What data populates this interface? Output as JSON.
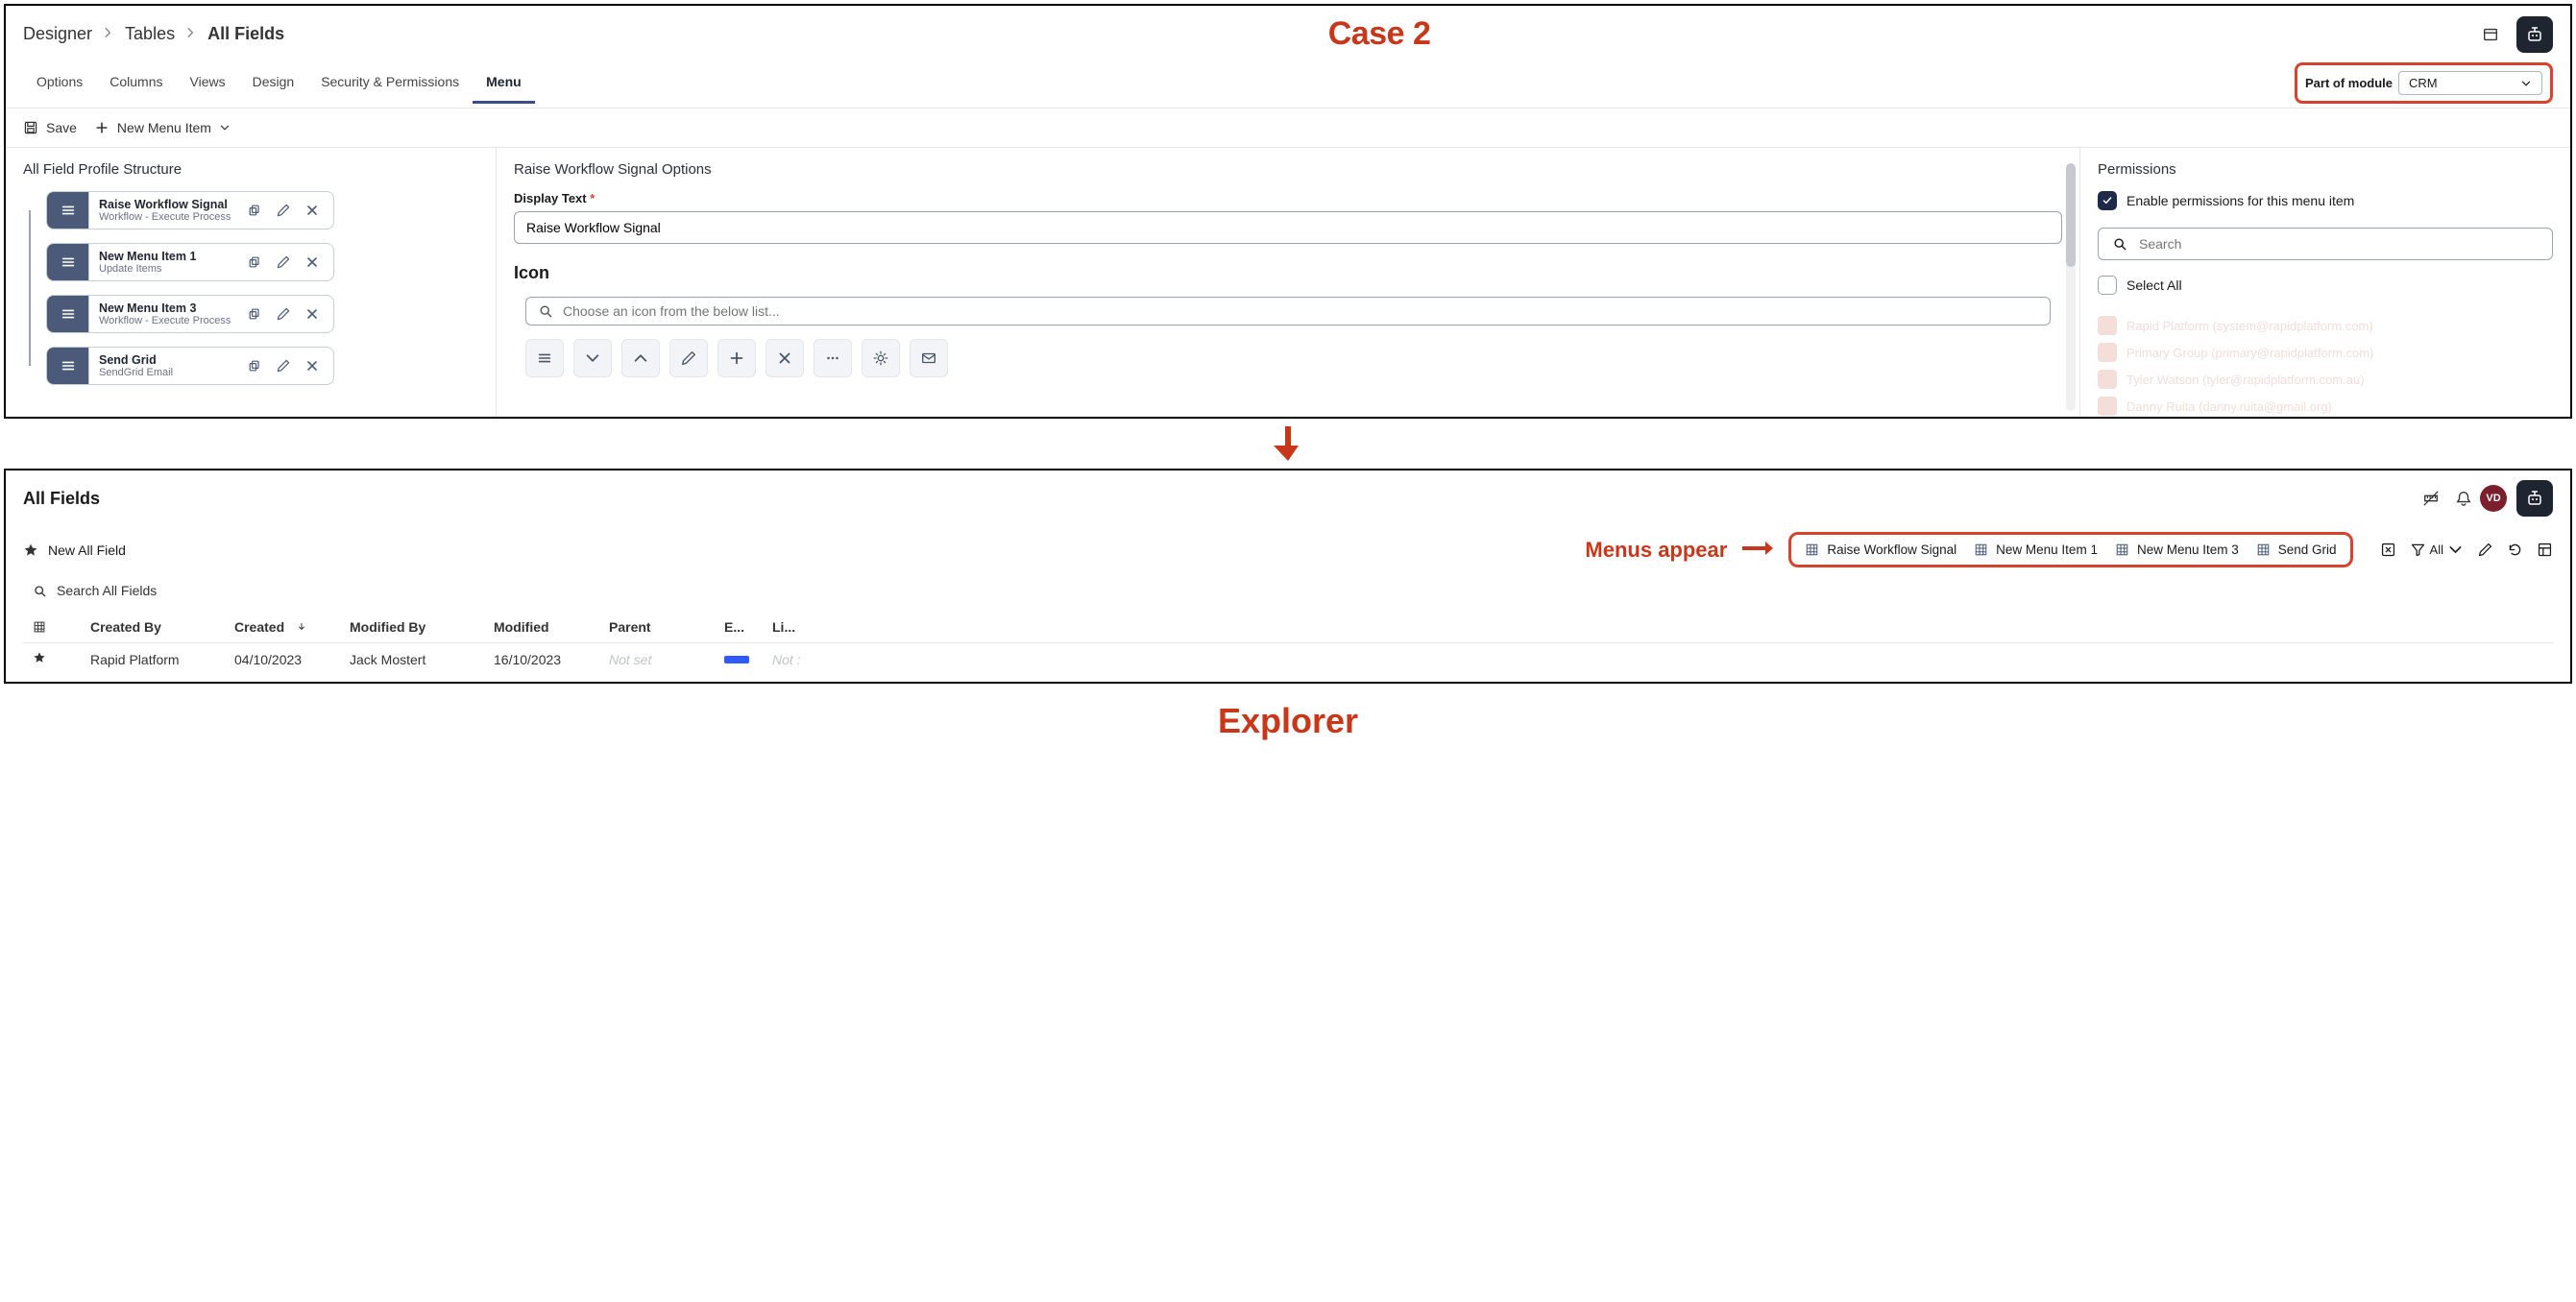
{
  "annotations": {
    "case": "Case 2",
    "menus_appear": "Menus appear",
    "explorer": "Explorer"
  },
  "designer": {
    "breadcrumbs": [
      "Designer",
      "Tables",
      "All Fields"
    ],
    "tabs": [
      "Options",
      "Columns",
      "Views",
      "Design",
      "Security & Permissions",
      "Menu"
    ],
    "active_tab": "Menu",
    "module_label": "Part of module",
    "module_value": "CRM",
    "toolbar": {
      "save": "Save",
      "new_menu_item": "New Menu Item"
    },
    "left_panel": {
      "title": "All Field Profile Structure",
      "items": [
        {
          "title": "Raise Workflow Signal",
          "sub": "Workflow - Execute Process"
        },
        {
          "title": "New Menu Item 1",
          "sub": "Update Items"
        },
        {
          "title": "New Menu Item 3",
          "sub": "Workflow - Execute Process"
        },
        {
          "title": "Send Grid",
          "sub": "SendGrid Email"
        }
      ]
    },
    "mid_panel": {
      "title": "Raise Workflow Signal Options",
      "display_text_label": "Display Text",
      "display_text_value": "Raise Workflow Signal",
      "icon_heading": "Icon",
      "icon_search_placeholder": "Choose an icon from the below list..."
    },
    "right_panel": {
      "title": "Permissions",
      "enable_label": "Enable permissions for this menu item",
      "search_placeholder": "Search",
      "select_all": "Select All",
      "list": [
        "Rapid Platform (system@rapidplatform.com)",
        "Primary Group (primary@rapidplatform.com)",
        "Tyler Watson (tyler@rapidplatform.com.au)",
        "Danny Ruita (danny.ruita@gmail.org)"
      ]
    }
  },
  "explorer": {
    "title": "All Fields",
    "avatar_initials": "VD",
    "new_label": "New All Field",
    "menus": [
      "Raise Workflow Signal",
      "New Menu Item 1",
      "New Menu Item 3",
      "Send Grid"
    ],
    "filter_all": "All",
    "search_placeholder": "Search All Fields",
    "columns": [
      "Created By",
      "Created",
      "Modified By",
      "Modified",
      "Parent",
      "E...",
      "Li..."
    ],
    "row": {
      "created_by": "Rapid Platform",
      "created": "04/10/2023",
      "modified_by": "Jack Mostert",
      "modified": "16/10/2023",
      "parent": "Not set",
      "li": "Not :"
    }
  }
}
